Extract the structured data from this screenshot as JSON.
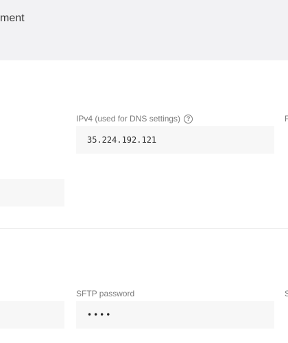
{
  "header": {
    "title": "ment"
  },
  "server_info": {
    "ipv4_label": "IPv4 (used for DNS settings)",
    "ipv4_value": "35.224.192.121",
    "right_label_fragment": "F"
  },
  "sftp": {
    "password_label": "SFTP password",
    "password_value": "••••",
    "right_label_fragment": "S"
  },
  "icons": {
    "help": "help-circle-icon"
  }
}
